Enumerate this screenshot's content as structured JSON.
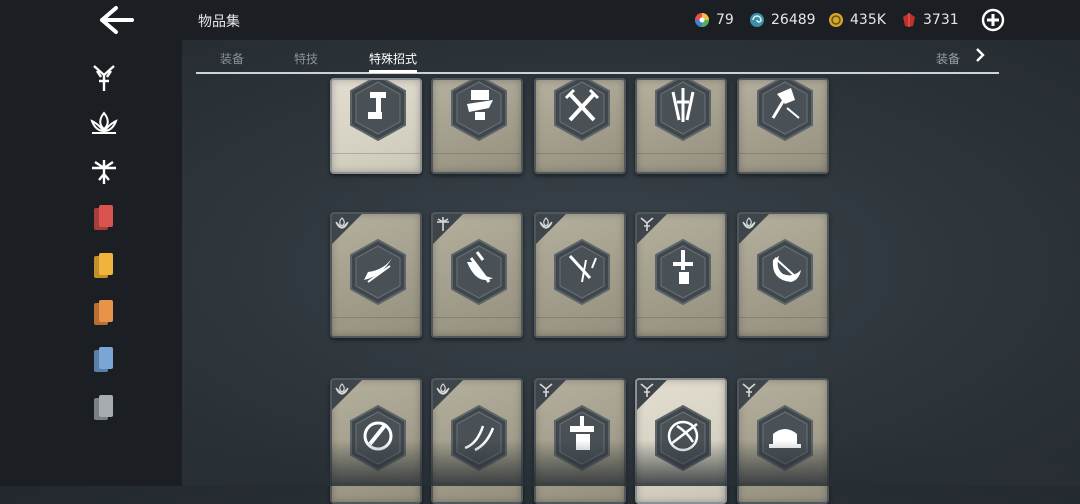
{
  "header": {
    "title": "物品集",
    "currencies": [
      {
        "icon": "rainbow-wheel-icon",
        "value": "79"
      },
      {
        "icon": "swirl-coin-icon",
        "value": "26489"
      },
      {
        "icon": "gold-coin-icon",
        "value": "435K"
      },
      {
        "icon": "red-gem-icon",
        "value": "3731"
      }
    ]
  },
  "tabs": [
    {
      "label": "装备",
      "active": false
    },
    {
      "label": "特技",
      "active": false
    },
    {
      "label": "特殊招式",
      "active": true
    }
  ],
  "next_tab_label": "装备",
  "sidebar": {
    "items": [
      {
        "icon": "sword-class-icon",
        "color": "#ffffff"
      },
      {
        "icon": "lotus-class-icon",
        "color": "#ffffff"
      },
      {
        "icon": "bow-class-icon",
        "color": "#ffffff"
      },
      {
        "icon": "red-cards-icon",
        "color": "#d9534f"
      },
      {
        "icon": "yellow-cards-icon",
        "color": "#f0b43c"
      },
      {
        "icon": "orange-cards-icon",
        "color": "#e8934a"
      },
      {
        "icon": "blue-cards-icon",
        "color": "#7aa6d6"
      },
      {
        "icon": "grey-cards-icon",
        "color": "#a7acb0"
      }
    ]
  },
  "cards": [
    {
      "row": 0,
      "col": 0,
      "class_icon": "",
      "skill_icon": "hammer-strike-icon",
      "selected": true
    },
    {
      "row": 0,
      "col": 1,
      "class_icon": "",
      "skill_icon": "ground-slam-icon",
      "selected": false
    },
    {
      "row": 0,
      "col": 2,
      "class_icon": "",
      "skill_icon": "cross-blades-icon",
      "selected": false
    },
    {
      "row": 0,
      "col": 3,
      "class_icon": "",
      "skill_icon": "triple-sword-icon",
      "selected": false
    },
    {
      "row": 0,
      "col": 4,
      "class_icon": "",
      "skill_icon": "axe-chop-icon",
      "selected": false
    },
    {
      "row": 1,
      "col": 0,
      "class_icon": "lotus-class-icon",
      "skill_icon": "scythe-slash-icon",
      "selected": false
    },
    {
      "row": 1,
      "col": 1,
      "class_icon": "bow-class-icon",
      "skill_icon": "crescent-axe-icon",
      "selected": false
    },
    {
      "row": 1,
      "col": 2,
      "class_icon": "lotus-class-icon",
      "skill_icon": "dagger-dive-icon",
      "selected": false
    },
    {
      "row": 1,
      "col": 3,
      "class_icon": "sword-class-icon",
      "skill_icon": "hilt-drop-icon",
      "selected": false
    },
    {
      "row": 1,
      "col": 4,
      "class_icon": "lotus-class-icon",
      "skill_icon": "crescent-moon-icon",
      "selected": false
    },
    {
      "row": 2,
      "col": 0,
      "class_icon": "lotus-class-icon",
      "skill_icon": "circle-slash-icon",
      "selected": false
    },
    {
      "row": 2,
      "col": 1,
      "class_icon": "lotus-class-icon",
      "skill_icon": "twin-scythe-icon",
      "selected": false
    },
    {
      "row": 2,
      "col": 2,
      "class_icon": "sword-class-icon",
      "skill_icon": "heavy-hammer-icon",
      "selected": false
    },
    {
      "row": 2,
      "col": 3,
      "class_icon": "sword-class-icon",
      "skill_icon": "bow-circle-icon",
      "selected": true
    },
    {
      "row": 2,
      "col": 4,
      "class_icon": "sword-class-icon",
      "skill_icon": "helmet-icon",
      "selected": false
    }
  ]
}
